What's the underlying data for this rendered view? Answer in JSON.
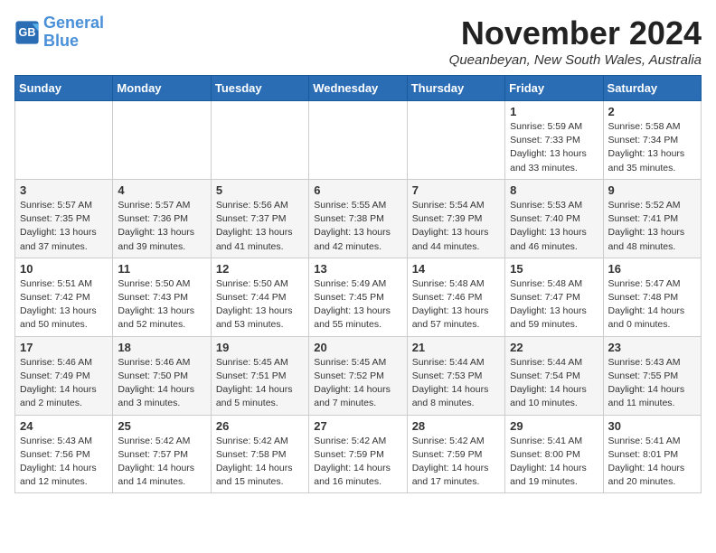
{
  "header": {
    "logo_line1": "General",
    "logo_line2": "Blue",
    "month_year": "November 2024",
    "location": "Queanbeyan, New South Wales, Australia"
  },
  "weekdays": [
    "Sunday",
    "Monday",
    "Tuesday",
    "Wednesday",
    "Thursday",
    "Friday",
    "Saturday"
  ],
  "weeks": [
    [
      {
        "day": "",
        "info": ""
      },
      {
        "day": "",
        "info": ""
      },
      {
        "day": "",
        "info": ""
      },
      {
        "day": "",
        "info": ""
      },
      {
        "day": "",
        "info": ""
      },
      {
        "day": "1",
        "info": "Sunrise: 5:59 AM\nSunset: 7:33 PM\nDaylight: 13 hours\nand 33 minutes."
      },
      {
        "day": "2",
        "info": "Sunrise: 5:58 AM\nSunset: 7:34 PM\nDaylight: 13 hours\nand 35 minutes."
      }
    ],
    [
      {
        "day": "3",
        "info": "Sunrise: 5:57 AM\nSunset: 7:35 PM\nDaylight: 13 hours\nand 37 minutes."
      },
      {
        "day": "4",
        "info": "Sunrise: 5:57 AM\nSunset: 7:36 PM\nDaylight: 13 hours\nand 39 minutes."
      },
      {
        "day": "5",
        "info": "Sunrise: 5:56 AM\nSunset: 7:37 PM\nDaylight: 13 hours\nand 41 minutes."
      },
      {
        "day": "6",
        "info": "Sunrise: 5:55 AM\nSunset: 7:38 PM\nDaylight: 13 hours\nand 42 minutes."
      },
      {
        "day": "7",
        "info": "Sunrise: 5:54 AM\nSunset: 7:39 PM\nDaylight: 13 hours\nand 44 minutes."
      },
      {
        "day": "8",
        "info": "Sunrise: 5:53 AM\nSunset: 7:40 PM\nDaylight: 13 hours\nand 46 minutes."
      },
      {
        "day": "9",
        "info": "Sunrise: 5:52 AM\nSunset: 7:41 PM\nDaylight: 13 hours\nand 48 minutes."
      }
    ],
    [
      {
        "day": "10",
        "info": "Sunrise: 5:51 AM\nSunset: 7:42 PM\nDaylight: 13 hours\nand 50 minutes."
      },
      {
        "day": "11",
        "info": "Sunrise: 5:50 AM\nSunset: 7:43 PM\nDaylight: 13 hours\nand 52 minutes."
      },
      {
        "day": "12",
        "info": "Sunrise: 5:50 AM\nSunset: 7:44 PM\nDaylight: 13 hours\nand 53 minutes."
      },
      {
        "day": "13",
        "info": "Sunrise: 5:49 AM\nSunset: 7:45 PM\nDaylight: 13 hours\nand 55 minutes."
      },
      {
        "day": "14",
        "info": "Sunrise: 5:48 AM\nSunset: 7:46 PM\nDaylight: 13 hours\nand 57 minutes."
      },
      {
        "day": "15",
        "info": "Sunrise: 5:48 AM\nSunset: 7:47 PM\nDaylight: 13 hours\nand 59 minutes."
      },
      {
        "day": "16",
        "info": "Sunrise: 5:47 AM\nSunset: 7:48 PM\nDaylight: 14 hours\nand 0 minutes."
      }
    ],
    [
      {
        "day": "17",
        "info": "Sunrise: 5:46 AM\nSunset: 7:49 PM\nDaylight: 14 hours\nand 2 minutes."
      },
      {
        "day": "18",
        "info": "Sunrise: 5:46 AM\nSunset: 7:50 PM\nDaylight: 14 hours\nand 3 minutes."
      },
      {
        "day": "19",
        "info": "Sunrise: 5:45 AM\nSunset: 7:51 PM\nDaylight: 14 hours\nand 5 minutes."
      },
      {
        "day": "20",
        "info": "Sunrise: 5:45 AM\nSunset: 7:52 PM\nDaylight: 14 hours\nand 7 minutes."
      },
      {
        "day": "21",
        "info": "Sunrise: 5:44 AM\nSunset: 7:53 PM\nDaylight: 14 hours\nand 8 minutes."
      },
      {
        "day": "22",
        "info": "Sunrise: 5:44 AM\nSunset: 7:54 PM\nDaylight: 14 hours\nand 10 minutes."
      },
      {
        "day": "23",
        "info": "Sunrise: 5:43 AM\nSunset: 7:55 PM\nDaylight: 14 hours\nand 11 minutes."
      }
    ],
    [
      {
        "day": "24",
        "info": "Sunrise: 5:43 AM\nSunset: 7:56 PM\nDaylight: 14 hours\nand 12 minutes."
      },
      {
        "day": "25",
        "info": "Sunrise: 5:42 AM\nSunset: 7:57 PM\nDaylight: 14 hours\nand 14 minutes."
      },
      {
        "day": "26",
        "info": "Sunrise: 5:42 AM\nSunset: 7:58 PM\nDaylight: 14 hours\nand 15 minutes."
      },
      {
        "day": "27",
        "info": "Sunrise: 5:42 AM\nSunset: 7:59 PM\nDaylight: 14 hours\nand 16 minutes."
      },
      {
        "day": "28",
        "info": "Sunrise: 5:42 AM\nSunset: 7:59 PM\nDaylight: 14 hours\nand 17 minutes."
      },
      {
        "day": "29",
        "info": "Sunrise: 5:41 AM\nSunset: 8:00 PM\nDaylight: 14 hours\nand 19 minutes."
      },
      {
        "day": "30",
        "info": "Sunrise: 5:41 AM\nSunset: 8:01 PM\nDaylight: 14 hours\nand 20 minutes."
      }
    ]
  ]
}
